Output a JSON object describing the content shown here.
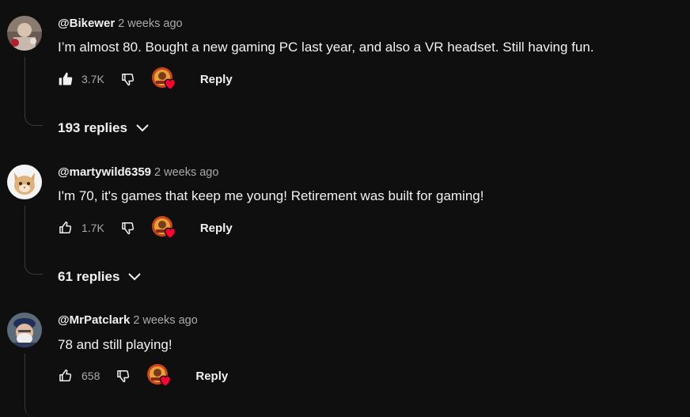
{
  "comments": [
    {
      "author": "@Bikewer",
      "time": "2 weeks ago",
      "text": "I’m almost 80.  Bought a new gaming PC last year, and also a VR headset.  Still having fun.",
      "likes": "3.7K",
      "reply_label": "Reply",
      "replies_label": "193 replies",
      "like_filled": true
    },
    {
      "author": "@martywild6359",
      "time": "2 weeks ago",
      "text": "I'm 70, it's games that keep me young! Retirement was built for gaming!",
      "likes": "1.7K",
      "reply_label": "Reply",
      "replies_label": "61 replies",
      "like_filled": false
    },
    {
      "author": "@MrPatclark",
      "time": "2 weeks ago",
      "text": "78 and still playing!",
      "likes": "658",
      "reply_label": "Reply",
      "like_filled": false
    }
  ],
  "colors": {
    "background": "#0f0f0f",
    "text_primary": "#f1f1f1",
    "text_secondary": "#aaaaaa",
    "heart": "#ff0033"
  },
  "icons": {
    "like": "thumbs-up-icon",
    "dislike": "thumbs-down-icon",
    "heart": "creator-heart-icon",
    "expand": "chevron-down-icon"
  }
}
